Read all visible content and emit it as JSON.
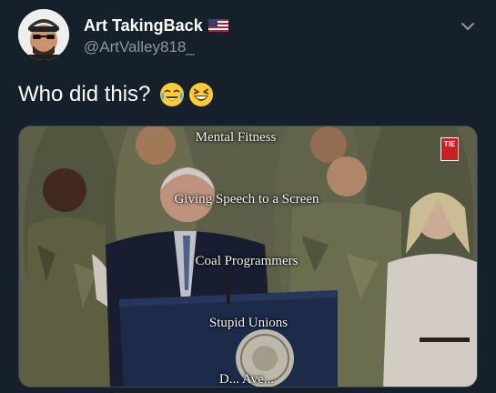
{
  "tweet": {
    "display_name": "Art TakingBack",
    "handle": "@ArtValley818_",
    "text": "Who did this?",
    "emojis": [
      "face-with-tears-of-joy-icon",
      "grinning-squinting-face-icon"
    ]
  },
  "media": {
    "captions": [
      "Mental Fitness",
      "Giving Speech to a Screen",
      "Coal Programmers",
      "Stupid Unions",
      "D... Ave..."
    ],
    "logo_text": "TIE"
  },
  "colors": {
    "background": "#15202b",
    "secondary_text": "#8899a6",
    "flag_red": "#b22234",
    "flag_blue": "#3c3b6e"
  }
}
